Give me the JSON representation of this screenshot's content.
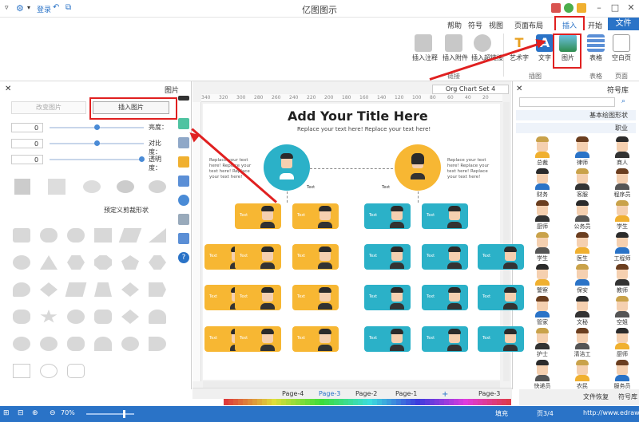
{
  "app": {
    "title": "亿图图示",
    "file_tab": "文件"
  },
  "quick_access": {
    "mode_label": "登录"
  },
  "tabs": [
    "开始",
    "插入",
    "页面布局",
    "视图",
    "符号",
    "帮助"
  ],
  "ribbon": {
    "buttons": [
      {
        "label": "空白页",
        "icon": "blank-page-icon"
      },
      {
        "label": "表格",
        "icon": "table-icon"
      },
      {
        "label": "图片",
        "icon": "picture-icon"
      },
      {
        "label": "表格",
        "icon": "chart-icon"
      },
      {
        "label": "文字",
        "icon": "text-icon"
      },
      {
        "label": "艺术字",
        "icon": "wordart-icon"
      },
      {
        "label": "插入超链接",
        "icon": "hyperlink-icon"
      },
      {
        "label": "插入附件",
        "icon": "attachment-icon"
      },
      {
        "label": "插入注释",
        "icon": "comment-icon"
      }
    ],
    "groups": [
      "页面",
      "表格",
      "插图",
      "链接"
    ]
  },
  "left_panel": {
    "title": "图片",
    "insert_picture": "插入图片",
    "change_picture": "改变图片",
    "brightness_label": "亮度：",
    "contrast_label": "对比度：",
    "transparency_label": "透明度：",
    "brightness_value": "0",
    "contrast_value": "0",
    "transparency_value": "0",
    "brightness_level": 0.5,
    "contrast_level": 0.5,
    "transparency_level": 0.0,
    "shapes_label": "预定义剪裁形状"
  },
  "document": {
    "tab_label": "Org Chart Set 4",
    "title": "Add Your Title Here",
    "subtitle": "Replace your text here!  Replace your text here!",
    "blurb": "Replace your text here! Replace your text here! Replace your text here!",
    "node_label": "Text",
    "card_label": "Text",
    "ruler_marks": [
      "340",
      "320",
      "300",
      "280",
      "260",
      "240",
      "220",
      "200",
      "180",
      "160",
      "140",
      "120",
      "100",
      "80",
      "60",
      "40",
      "20"
    ]
  },
  "right_panel": {
    "title": "符号库",
    "categories": [
      "基本绘图形状",
      "职业"
    ],
    "people": [
      [
        "商人",
        "律师",
        "总裁"
      ],
      [
        "程序员",
        "客服",
        "财务"
      ],
      [
        "学生",
        "公务员",
        "厨师"
      ],
      [
        "工程师",
        "医生",
        "学生"
      ],
      [
        "教师",
        "保安",
        "警察"
      ],
      [
        "空姐",
        "文秘",
        "管家"
      ],
      [
        "厨师",
        "清洁工",
        "护士"
      ],
      [
        "服务员",
        "农民",
        "快递员"
      ]
    ],
    "bottom_tab": "文件恢复",
    "bottom_tab2": "符号库"
  },
  "page_tabs": {
    "current": "Page-3",
    "tabs": [
      "Page-1",
      "Page-2",
      "Page-3",
      "Page-4"
    ]
  },
  "status": {
    "url": "http://www.edrawsoft.com",
    "page_info": "页3/4",
    "fill_label": "填充",
    "zoom": "70%"
  },
  "colors": {
    "accent": "#2a73c7",
    "annotation": "#e02020",
    "teal": "#2bb1c8",
    "amber": "#f7b733"
  }
}
